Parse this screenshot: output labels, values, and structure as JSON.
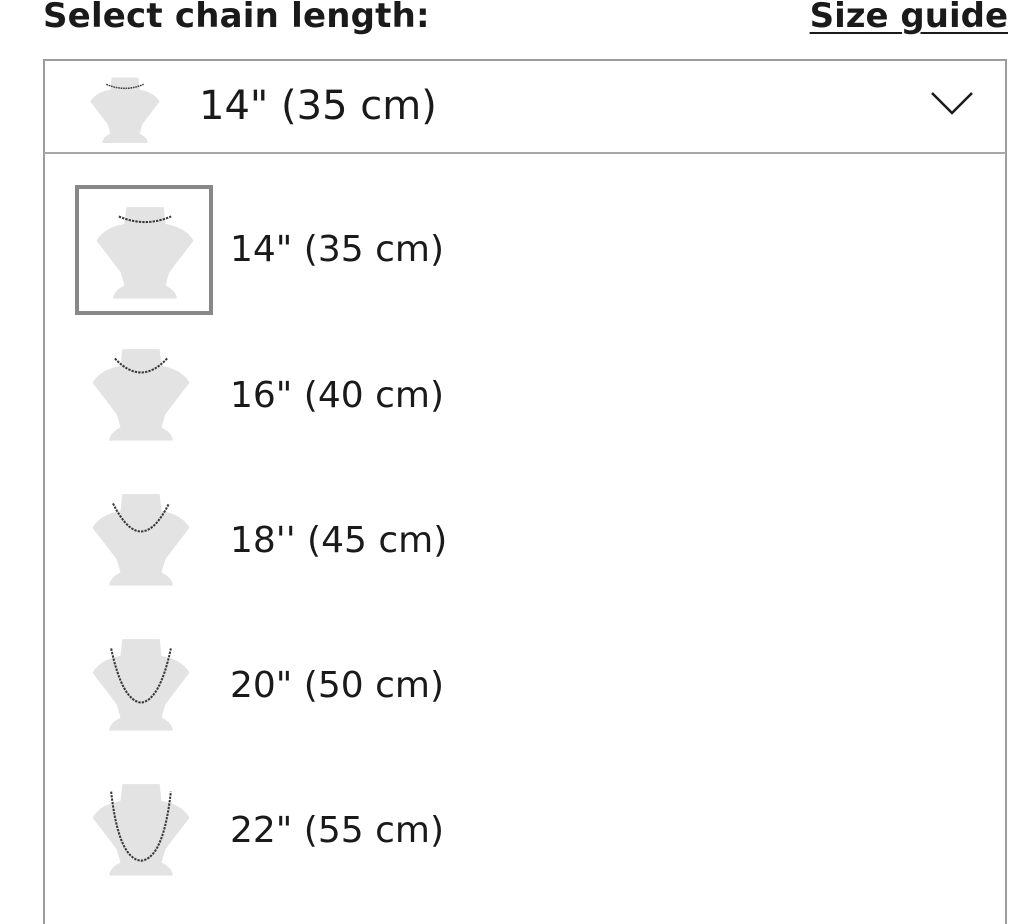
{
  "header": {
    "title": "Select chain length:",
    "size_guide_label": "Size guide"
  },
  "select": {
    "value": "14\" (35 cm)",
    "icon": "bust-necklace-icon",
    "chevron_icon": "chevron-down-icon"
  },
  "options": [
    {
      "label": "14\" (35 cm)",
      "selected": true,
      "icon": "bust-necklace-icon"
    },
    {
      "label": "16\" (40 cm)",
      "selected": false,
      "icon": "bust-necklace-icon"
    },
    {
      "label": "18'' (45 cm)",
      "selected": false,
      "icon": "bust-necklace-icon"
    },
    {
      "label": "20\" (50 cm)",
      "selected": false,
      "icon": "bust-necklace-icon"
    },
    {
      "label": "22\" (55 cm)",
      "selected": false,
      "icon": "bust-necklace-icon"
    }
  ],
  "colors": {
    "bust_fill": "#e3e3e3",
    "chain_stroke": "#3a3a3a",
    "border": "#9c9c9c",
    "selected_border": "#888888"
  }
}
